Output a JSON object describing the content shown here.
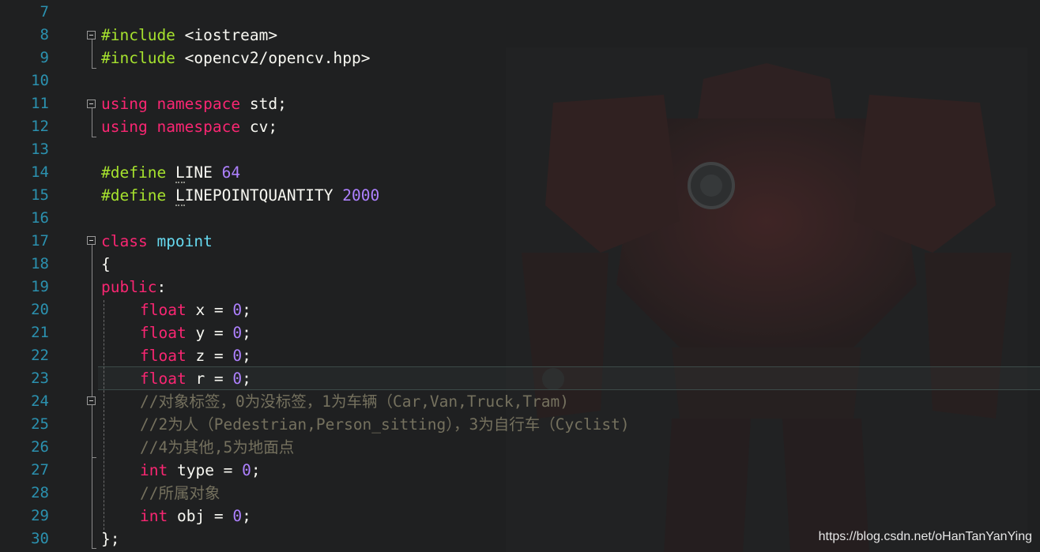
{
  "line_numbers": [
    "7",
    "8",
    "9",
    "10",
    "11",
    "12",
    "13",
    "14",
    "15",
    "16",
    "17",
    "18",
    "19",
    "20",
    "21",
    "22",
    "23",
    "24",
    "25",
    "26",
    "27",
    "28",
    "29",
    "30"
  ],
  "code": {
    "l8": {
      "kw": "#include",
      "a": " ",
      "b": "<iostream>"
    },
    "l9": {
      "kw": "#include",
      "a": " ",
      "b": "<opencv2/opencv.hpp>"
    },
    "l11": {
      "k1": "using",
      "k2": "namespace",
      "id": "std;"
    },
    "l12": {
      "k1": "using",
      "k2": "namespace",
      "id": "cv;"
    },
    "l14": {
      "kw": "#define",
      "name_first": "L",
      "name_rest": "INE",
      "val": "64"
    },
    "l15": {
      "kw": "#define",
      "name_first": "L",
      "name_rest": "INEPOINTQUANTITY",
      "val": "2000"
    },
    "l17": {
      "kw": "class",
      "name": "mpoint"
    },
    "l18": {
      "text": "{"
    },
    "l19": {
      "kw": "public",
      "rest": ":"
    },
    "l20": {
      "type": "float",
      "mid": " x = ",
      "val": "0",
      "end": ";"
    },
    "l21": {
      "type": "float",
      "mid": " y = ",
      "val": "0",
      "end": ";"
    },
    "l22": {
      "type": "float",
      "mid": " z = ",
      "val": "0",
      "end": ";"
    },
    "l23": {
      "type": "float",
      "mid": " r = ",
      "val": "0",
      "end": ";"
    },
    "l24": {
      "comment": "//对象标签，0为没标签，1为车辆（Car,Van,Truck,Tram)"
    },
    "l25": {
      "comment": "//2为人（Pedestrian,Person_sitting），3为自行车（Cyclist)"
    },
    "l26": {
      "comment": "//4为其他,5为地面点"
    },
    "l27": {
      "type": "int",
      "mid": " type = ",
      "val": "0",
      "end": ";"
    },
    "l28": {
      "comment": "//所属对象"
    },
    "l29": {
      "type": "int",
      "mid": " obj = ",
      "val": "0",
      "end": ";"
    },
    "l30": {
      "text": "};"
    }
  },
  "watermark": "https://blog.csdn.net/oHanTanYanYing",
  "colors": {
    "background": "#1f2021",
    "line_number": "#2b91af",
    "preprocessor": "#a6e22e",
    "keyword": "#f92672",
    "number": "#ae81ff",
    "class_name": "#66d9ef",
    "comment": "#75715e",
    "text": "#f8f8f2"
  }
}
